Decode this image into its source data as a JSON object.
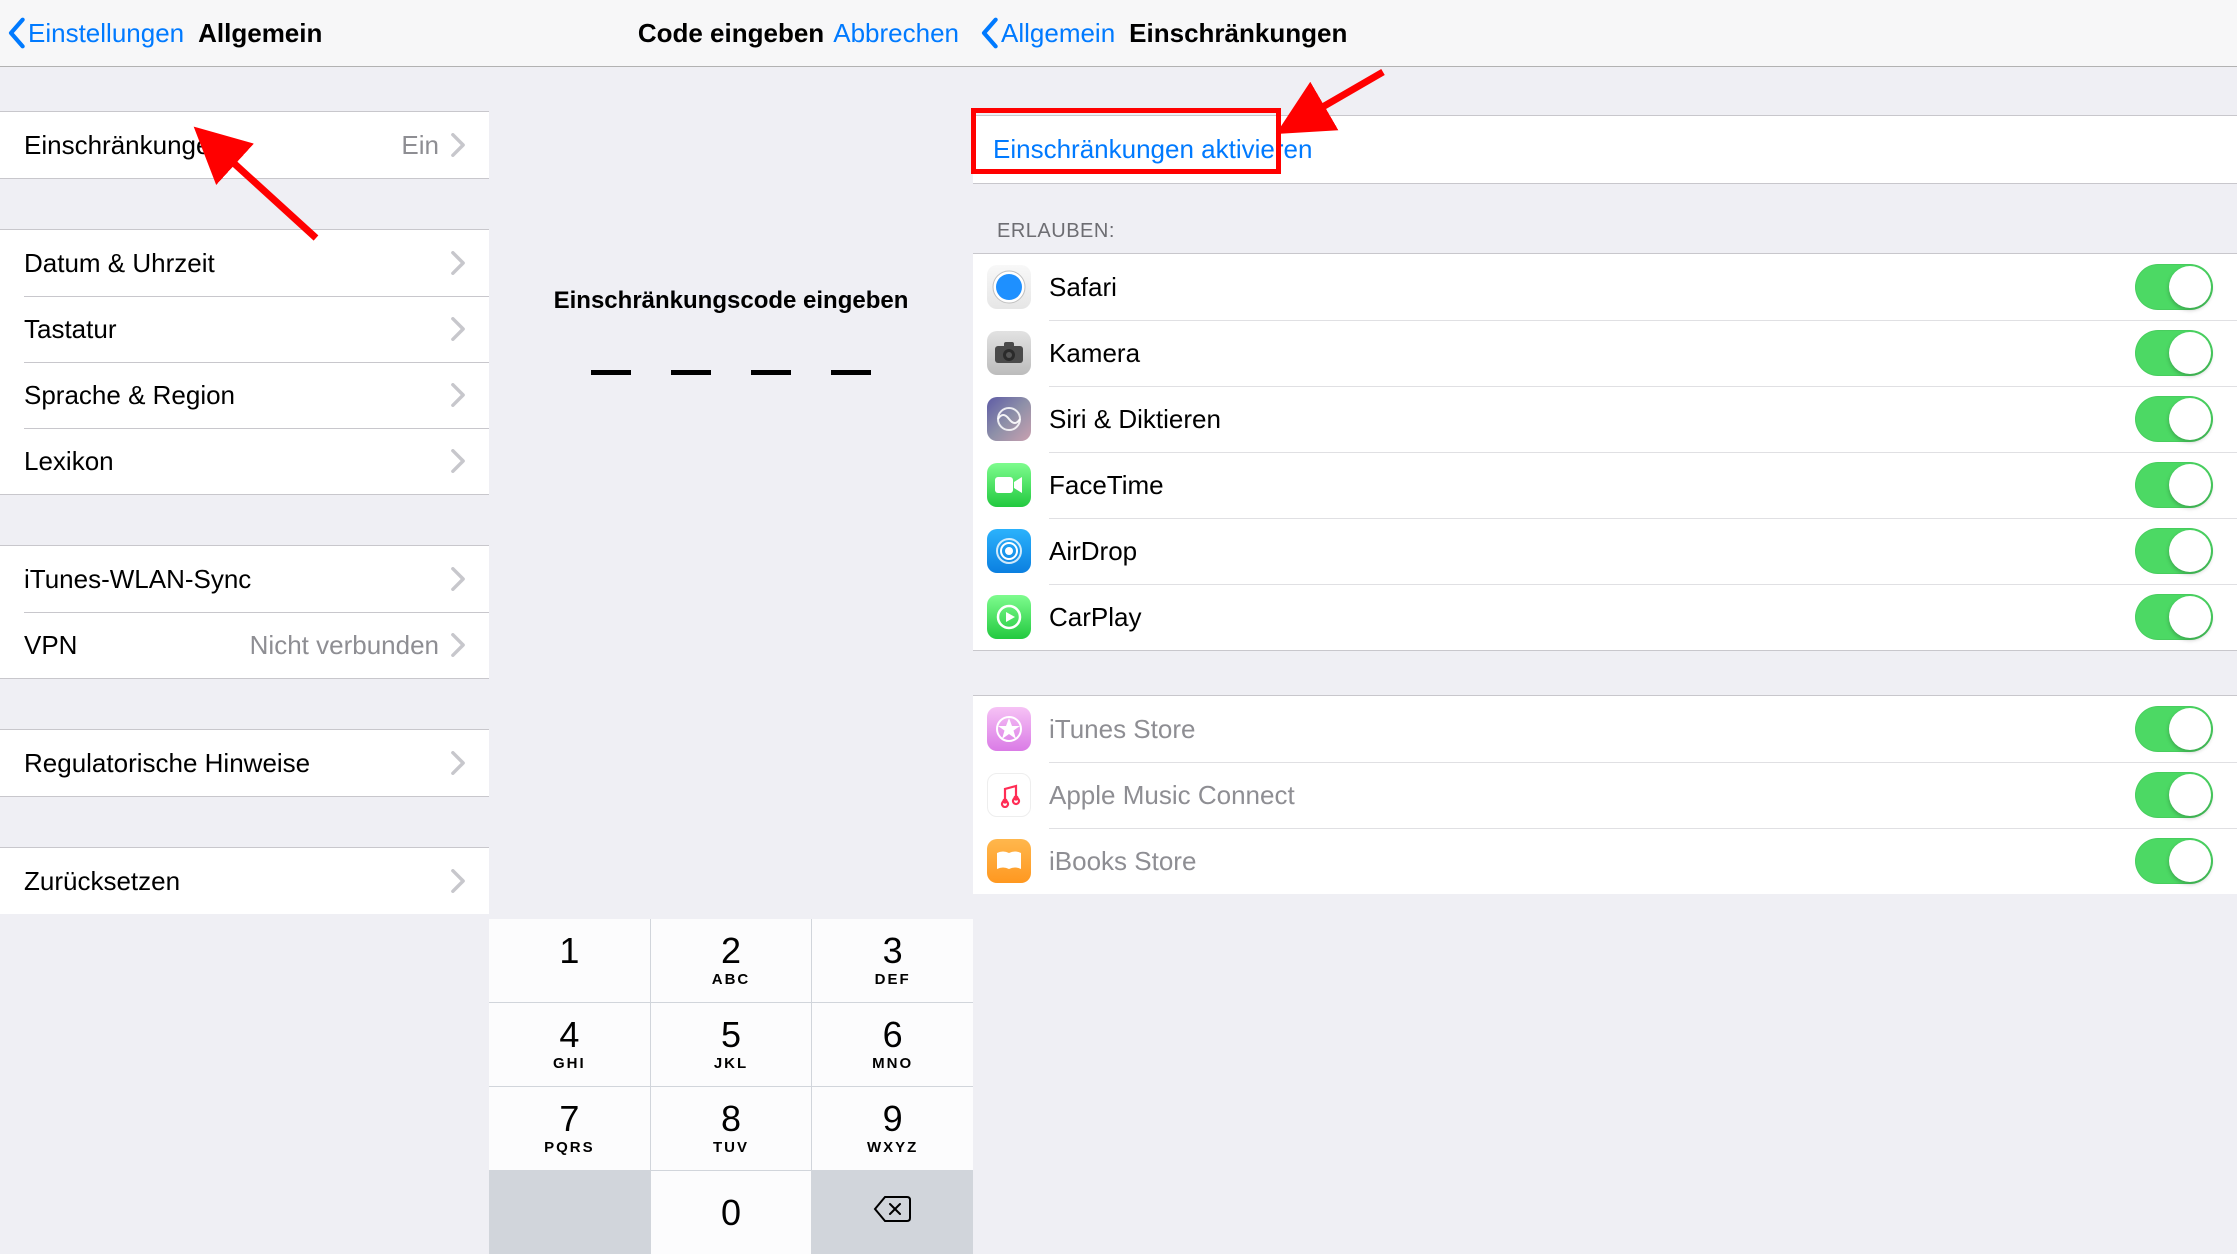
{
  "pane1": {
    "back": "Einstellungen",
    "title": "Allgemein",
    "rows": {
      "restrictions": {
        "label": "Einschränkungen",
        "value": "Ein"
      },
      "datetime": {
        "label": "Datum & Uhrzeit"
      },
      "keyboard": {
        "label": "Tastatur"
      },
      "language": {
        "label": "Sprache & Region"
      },
      "dictionary": {
        "label": "Lexikon"
      },
      "itunes_sync": {
        "label": "iTunes-WLAN-Sync"
      },
      "vpn": {
        "label": "VPN",
        "value": "Nicht verbunden"
      },
      "regulatory": {
        "label": "Regulatorische Hinweise"
      },
      "reset": {
        "label": "Zurücksetzen"
      }
    }
  },
  "pane2": {
    "title": "Code eingeben",
    "cancel": "Abbrechen",
    "prompt": "Einschränkungscode eingeben",
    "keys": [
      {
        "n": "1",
        "l": ""
      },
      {
        "n": "2",
        "l": "ABC"
      },
      {
        "n": "3",
        "l": "DEF"
      },
      {
        "n": "4",
        "l": "GHI"
      },
      {
        "n": "5",
        "l": "JKL"
      },
      {
        "n": "6",
        "l": "MNO"
      },
      {
        "n": "7",
        "l": "PQRS"
      },
      {
        "n": "8",
        "l": "TUV"
      },
      {
        "n": "9",
        "l": "WXYZ"
      },
      {
        "n": "",
        "l": ""
      },
      {
        "n": "0",
        "l": ""
      },
      {
        "n": "del",
        "l": ""
      }
    ]
  },
  "pane3": {
    "back": "Allgemein",
    "title": "Einschränkungen",
    "activate": "Einschränkungen aktivieren",
    "section": "ERLAUBEN:",
    "apps1": [
      {
        "icon": "safari",
        "label": "Safari"
      },
      {
        "icon": "camera",
        "label": "Kamera"
      },
      {
        "icon": "siri",
        "label": "Siri & Diktieren"
      },
      {
        "icon": "facetime",
        "label": "FaceTime"
      },
      {
        "icon": "airdrop",
        "label": "AirDrop"
      },
      {
        "icon": "carplay",
        "label": "CarPlay"
      }
    ],
    "apps2": [
      {
        "icon": "itunes",
        "label": "iTunes Store"
      },
      {
        "icon": "music",
        "label": "Apple Music Connect"
      },
      {
        "icon": "ibooks",
        "label": "iBooks Store"
      }
    ]
  },
  "colors": {
    "link": "#007aff",
    "red": "#ff0000",
    "toggle": "#4cd964"
  }
}
